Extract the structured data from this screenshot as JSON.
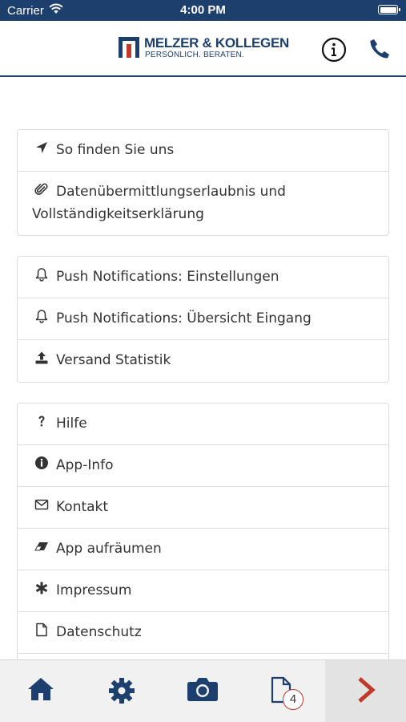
{
  "status_bar": {
    "carrier": "Carrier",
    "time": "4:00 PM"
  },
  "header": {
    "logo_title": "MELZER & KOLLEGEN",
    "logo_subtitle": "PERSÖNLICH. BERATEN.",
    "info_icon": "info-circle-icon",
    "phone_icon": "phone-icon",
    "brand_color": "#1d3f6e"
  },
  "menu": {
    "group1": [
      {
        "label": "So finden Sie uns",
        "icon": "location-arrow-icon"
      },
      {
        "label": "Datenübermittlungserlaubnis und Vollständigkeitserklärung",
        "icon": "paperclip-icon"
      }
    ],
    "group2": [
      {
        "label": "Push Notifications: Einstellungen",
        "icon": "bell-icon"
      },
      {
        "label": "Push Notifications: Übersicht Eingang",
        "icon": "bell-icon"
      },
      {
        "label": "Versand Statistik",
        "icon": "upload-icon"
      }
    ],
    "group3": [
      {
        "label": "Hilfe",
        "icon": "question-icon"
      },
      {
        "label": "App-Info",
        "icon": "info-icon"
      },
      {
        "label": "Kontakt",
        "icon": "envelope-icon"
      },
      {
        "label": "App aufräumen",
        "icon": "eraser-icon"
      },
      {
        "label": "Impressum",
        "icon": "asterisk-icon"
      },
      {
        "label": "Datenschutz",
        "icon": "file-icon"
      }
    ]
  },
  "tabbar": {
    "tabs": [
      "home-icon",
      "gear-icon",
      "camera-icon",
      "document-icon",
      "chevron-right-icon"
    ],
    "documents_badge": "4",
    "accent_color": "#c0392b"
  }
}
